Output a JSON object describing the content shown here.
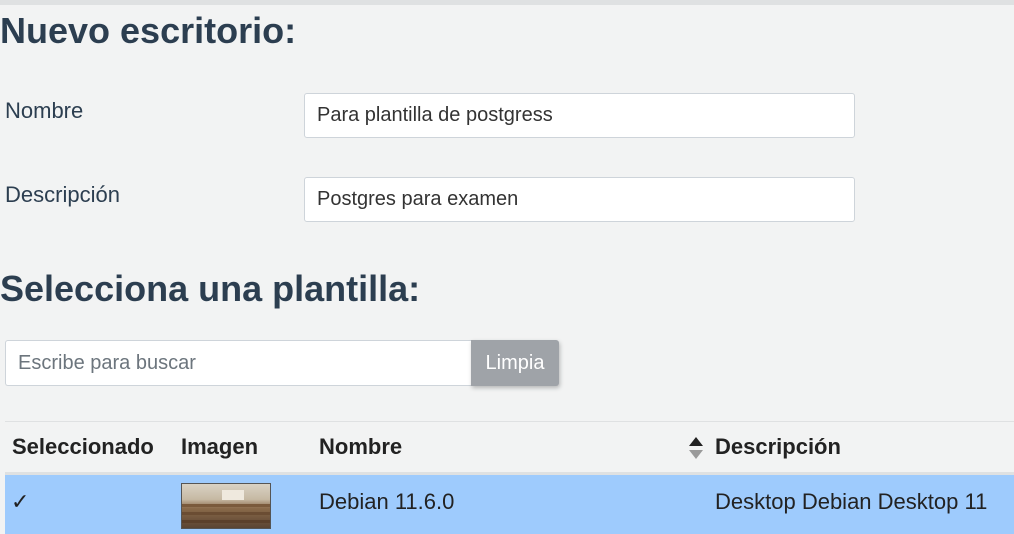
{
  "form": {
    "heading": "Nuevo escritorio:",
    "name_label": "Nombre",
    "name_value": "Para plantilla de postgress",
    "description_label": "Descripción",
    "description_value": "Postgres para examen"
  },
  "templates": {
    "heading": "Selecciona una plantilla:",
    "search_placeholder": "Escribe para buscar",
    "clear_label": "Limpia",
    "columns": {
      "selected": "Seleccionado",
      "image": "Imagen",
      "name": "Nombre",
      "description": "Descripción"
    },
    "rows": [
      {
        "selected": "✓",
        "image_icon": "classroom-thumbnail",
        "name": "Debian 11.6.0",
        "description": "Desktop Debian Desktop 11"
      }
    ]
  },
  "colors": {
    "selected_row": "#9ecbfd",
    "clear_button": "#9fa3a8",
    "heading": "#2c3e50"
  },
  "icons": {
    "sort": "sort-up-down-icon",
    "check": "check-icon"
  }
}
